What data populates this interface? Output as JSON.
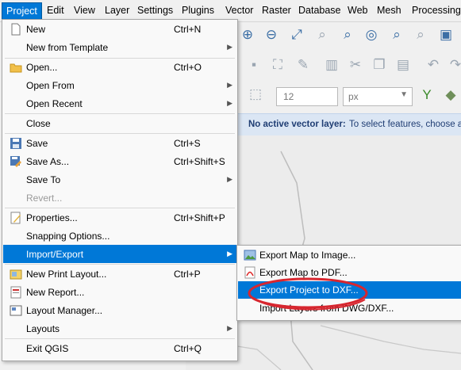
{
  "menubar": {
    "items": [
      {
        "label": "Project"
      },
      {
        "label": "Edit"
      },
      {
        "label": "View"
      },
      {
        "label": "Layer"
      },
      {
        "label": "Settings"
      },
      {
        "label": "Plugins"
      },
      {
        "label": "Vector"
      },
      {
        "label": "Raster"
      },
      {
        "label": "Database"
      },
      {
        "label": "Web"
      },
      {
        "label": "Mesh"
      },
      {
        "label": "Processing"
      }
    ]
  },
  "project_menu": {
    "items": [
      {
        "label": "New",
        "shortcut": "Ctrl+N"
      },
      {
        "label": "New from Template"
      },
      {
        "label": "Open...",
        "shortcut": "Ctrl+O"
      },
      {
        "label": "Open From"
      },
      {
        "label": "Open Recent"
      },
      {
        "label": "Close"
      },
      {
        "label": "Save",
        "shortcut": "Ctrl+S"
      },
      {
        "label": "Save As...",
        "shortcut": "Ctrl+Shift+S"
      },
      {
        "label": "Save To"
      },
      {
        "label": "Revert..."
      },
      {
        "label": "Properties...",
        "shortcut": "Ctrl+Shift+P"
      },
      {
        "label": "Snapping Options..."
      },
      {
        "label": "Import/Export"
      },
      {
        "label": "New Print Layout...",
        "shortcut": "Ctrl+P"
      },
      {
        "label": "New Report..."
      },
      {
        "label": "Layout Manager..."
      },
      {
        "label": "Layouts"
      },
      {
        "label": "Exit QGIS",
        "shortcut": "Ctrl+Q"
      }
    ]
  },
  "import_export_submenu": {
    "items": [
      {
        "label": "Export Map to Image..."
      },
      {
        "label": "Export Map to PDF..."
      },
      {
        "label": "Export Project to DXF..."
      },
      {
        "label": "Import Layers from DWG/DXF..."
      }
    ]
  },
  "toolbar": {
    "font_size_value": "12",
    "unit_value": "px"
  },
  "infobar": {
    "title": "No active vector layer:",
    "message": "To select features, choose a"
  },
  "colors": {
    "highlight": "#0078d7",
    "annotation_oval": "#d7262f"
  }
}
